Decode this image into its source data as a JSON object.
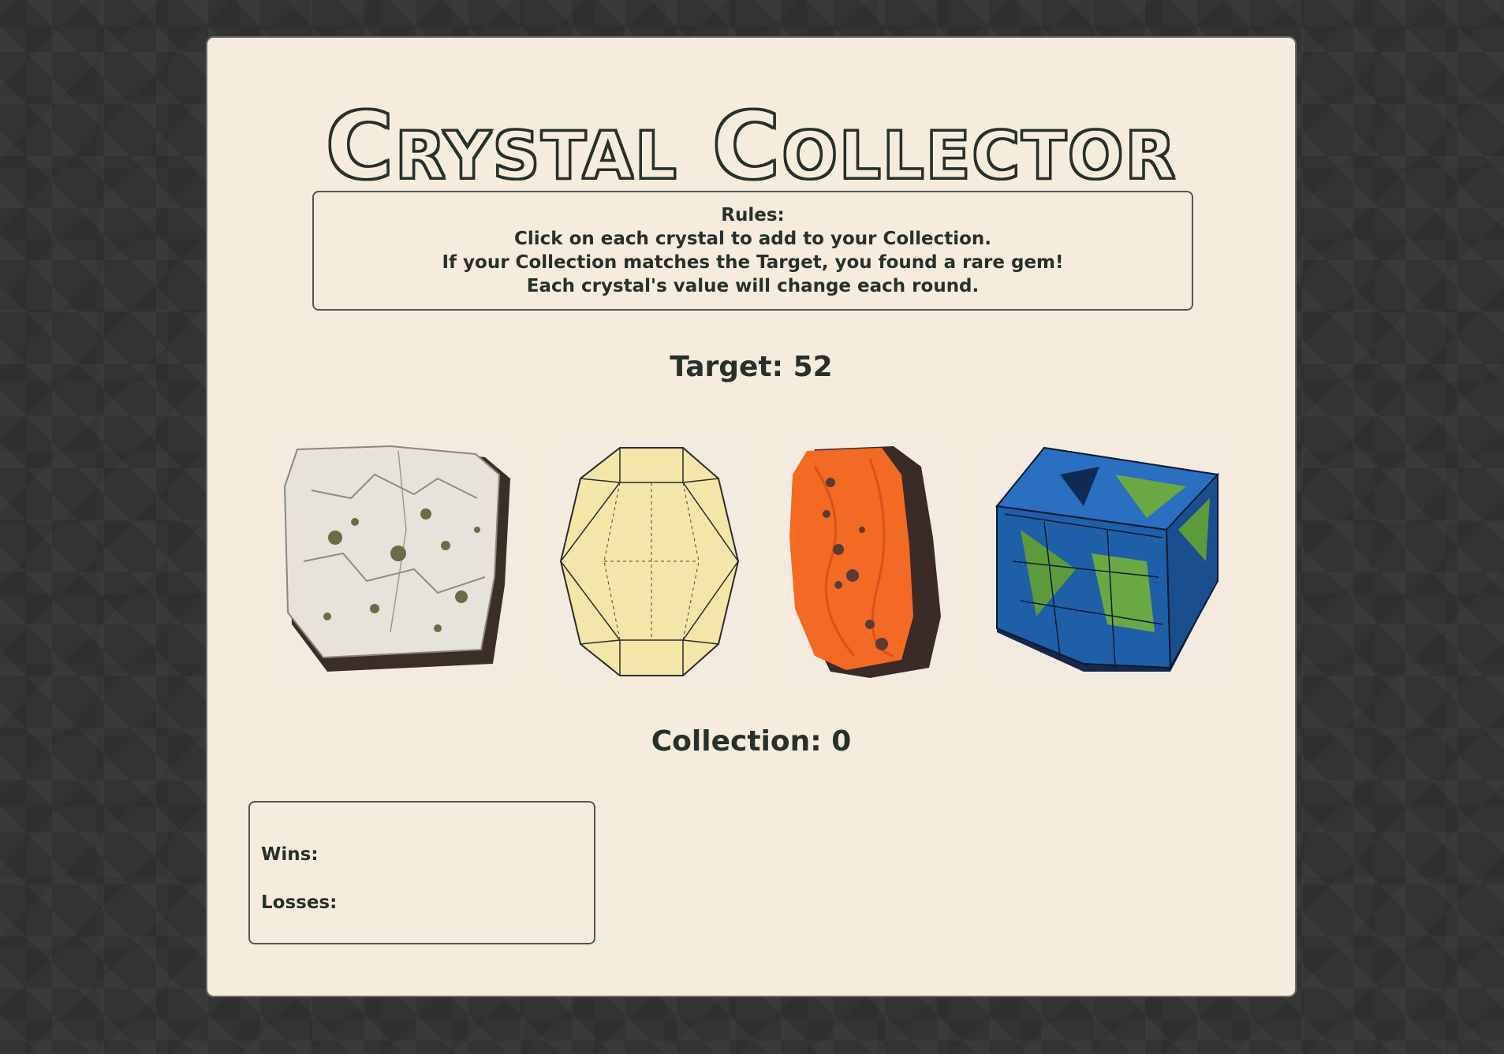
{
  "title": "Crystal Collector",
  "rules": {
    "heading": "Rules:",
    "line1": "Click on each crystal to add to your Collection.",
    "line2": "If your Collection matches the Target, you found a rare gem!",
    "line3": "Each crystal's value will change each round."
  },
  "target": {
    "label": "Target:",
    "value": "52"
  },
  "crystals": [
    {
      "name": "white speckled crystal",
      "color": "#e4e1d9",
      "icon": "white-rock-icon"
    },
    {
      "name": "pale yellow crystal",
      "color": "#f2e3a2",
      "icon": "yellow-gem-icon"
    },
    {
      "name": "orange crystal",
      "color": "#f26a24",
      "icon": "orange-rock-icon"
    },
    {
      "name": "blue green crystal",
      "color": "#1f5fa8",
      "icon": "blue-cube-icon"
    }
  ],
  "collection": {
    "label": "Collection:",
    "value": "0"
  },
  "score": {
    "wins_label": "Wins:",
    "wins_value": "",
    "losses_label": "Losses:",
    "losses_value": ""
  },
  "colors": {
    "background": "#333333",
    "panel": "#f6ecdd",
    "text": "#27302b",
    "border": "#555555"
  }
}
